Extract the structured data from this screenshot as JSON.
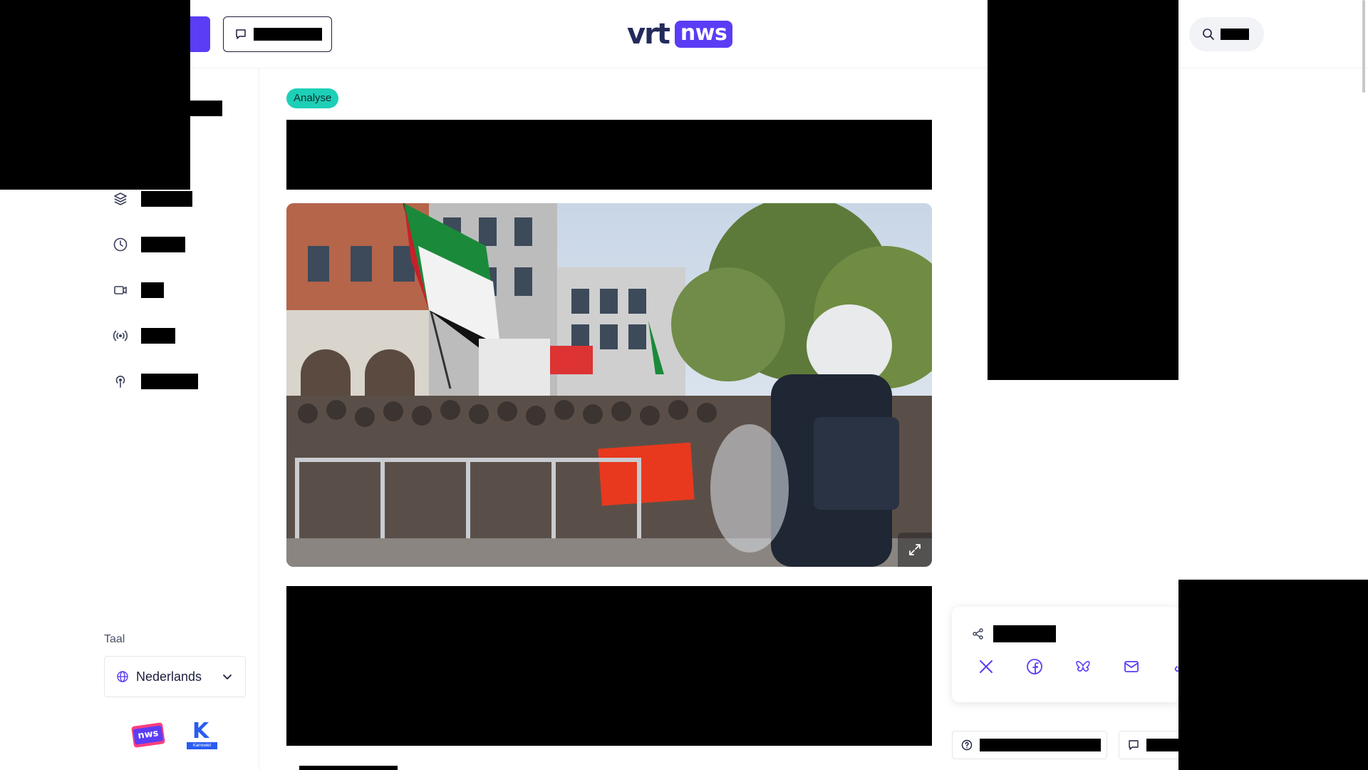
{
  "header": {
    "logo_vrt": "vrt",
    "logo_nws": "nws"
  },
  "sidebar": {
    "nav_icons": [
      "layers-icon",
      "clock-icon",
      "video-icon",
      "broadcast-icon",
      "podcast-icon"
    ],
    "language_label": "Taal",
    "language_value": "Nederlands",
    "brands": {
      "nws_badge": "nws",
      "ketnet_letter": "K",
      "ketnet_name": "Karrewiet"
    }
  },
  "article": {
    "tag": "Analyse",
    "hero_image": "protest-crowd-with-police-photo"
  },
  "share": {
    "icons": [
      "x-icon",
      "facebook-icon",
      "bluesky-icon",
      "mail-icon",
      "link-icon"
    ]
  },
  "colors": {
    "brand_purple": "#5a3df5",
    "tag_teal": "#1ecfb7",
    "navy": "#232b5b"
  }
}
